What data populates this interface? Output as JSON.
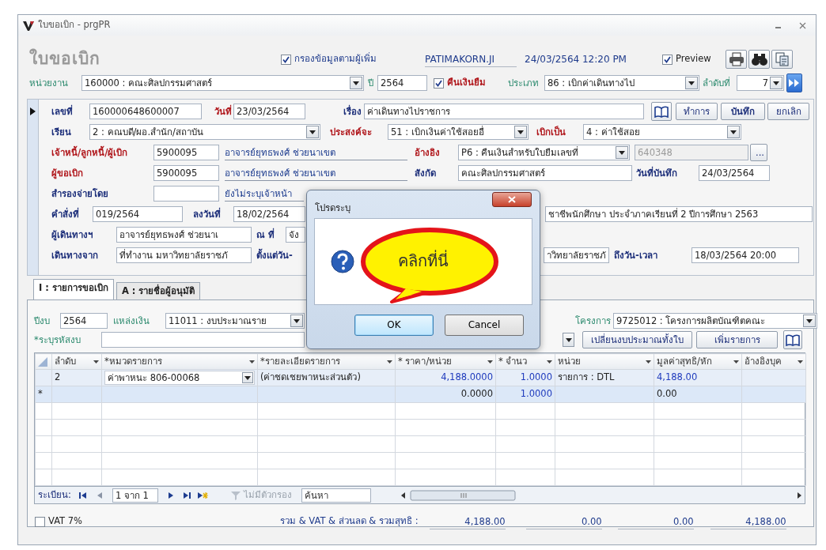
{
  "window": {
    "title": "ใบขอเบิก - prgPR"
  },
  "header": {
    "items": [
      {
        "kind": "heading",
        "text": "ใบขอเบิก"
      },
      {
        "kind": "checkbox",
        "label": "กรองข้อมูลตามผู้เพิ่ม",
        "checked": true
      },
      {
        "kind": "info",
        "text": "PATIMAKORN.JI"
      },
      {
        "kind": "info",
        "text": "24/03/2564  12:20 PM"
      },
      {
        "kind": "checkbox",
        "label": "Preview",
        "checked": true
      },
      {
        "kind": "icon_button"
      },
      {
        "kind": "icon_button"
      },
      {
        "kind": "icon_button"
      }
    ]
  },
  "selector": {
    "items": [
      {
        "kind": "label",
        "text": "หน่วยงาน"
      },
      {
        "kind": "combo",
        "value": "160000 : คณะศิลปกรรมศาสตร์"
      },
      {
        "kind": "label",
        "text": "ปี"
      },
      {
        "kind": "field",
        "value": "2564"
      },
      {
        "kind": "checkbox",
        "label": "คืนเงินยืม",
        "checked": true
      },
      {
        "kind": "label",
        "text": "ประเภท"
      },
      {
        "kind": "combo",
        "value": "86 : เบิกค่าเดินทางไป"
      },
      {
        "kind": "label",
        "text": "ลำดับที่"
      },
      {
        "kind": "combo",
        "value": "7"
      },
      {
        "kind": "icon_button"
      }
    ]
  },
  "form": {
    "rows": [
      {
        "items": [
          {
            "kind": "label",
            "text": "เลขที่",
            "required": false
          },
          {
            "kind": "field",
            "value": "160000648600007"
          },
          {
            "kind": "label",
            "text": "วันที่",
            "required": true
          },
          {
            "kind": "field",
            "value": "23/03/2564"
          },
          {
            "kind": "label",
            "text": "เรื่อง",
            "required": false
          },
          {
            "kind": "field",
            "value": "ค่าเดินทางไปราชการ"
          },
          {
            "kind": "icon_button"
          },
          {
            "kind": "button",
            "text": "ทำการ"
          },
          {
            "kind": "button",
            "text": "บันทึก"
          },
          {
            "kind": "button",
            "text": "ยกเลิก"
          }
        ]
      },
      {
        "items": [
          {
            "kind": "label",
            "text": "เรียน",
            "required": false
          },
          {
            "kind": "combo",
            "value": "2 : คณบดี/ผอ.สำนัก/สถาบัน"
          },
          {
            "kind": "label",
            "text": "ประสงค์จะ",
            "required": true
          },
          {
            "kind": "combo",
            "value": "51 : เบิกเงินค่าใช้สอยอื่"
          },
          {
            "kind": "label",
            "text": "เบิกเป็น",
            "required": true
          },
          {
            "kind": "combo",
            "value": "4 : ค่าใช้สอย"
          }
        ]
      },
      {
        "items": [
          {
            "kind": "label",
            "text": "เจ้าหนี้/ลูกหนี้/ผู้เบิก",
            "required": true
          },
          {
            "kind": "field",
            "value": "5900095"
          },
          {
            "kind": "name",
            "text": "อาจารย์ยุทธพงศ์ ช่วยนาเขต"
          },
          {
            "kind": "label",
            "text": "อ้างอิง",
            "required": true
          },
          {
            "kind": "combo",
            "value": "P6 : คืนเงินสำหรับใบยืมเลขที่"
          },
          {
            "kind": "readonly_field",
            "value": "640348"
          },
          {
            "kind": "button",
            "text": "..."
          }
        ]
      },
      {
        "items": [
          {
            "kind": "label",
            "text": "ผู้ขอเบิก",
            "required": true
          },
          {
            "kind": "field",
            "value": "5900095"
          },
          {
            "kind": "name",
            "text": "อาจารย์ยุทธพงศ์ ช่วยนาเขต"
          },
          {
            "kind": "label",
            "text": "สังกัด",
            "required": false
          },
          {
            "kind": "field",
            "value": "คณะศิลปกรรมศาสตร์"
          },
          {
            "kind": "label",
            "text": "วันที่บันทึก",
            "required": false
          },
          {
            "kind": "field",
            "value": "24/03/2564"
          }
        ]
      },
      {
        "items": [
          {
            "kind": "label",
            "text": "สำรองจ่ายโดย",
            "required": false
          },
          {
            "kind": "field"
          },
          {
            "kind": "name",
            "text": "ยังไม่ระบุเจ้าหน้า"
          }
        ]
      },
      {
        "items": [
          {
            "kind": "label",
            "text": "คำสั่งที่",
            "required": false
          },
          {
            "kind": "field",
            "value": "019/2564"
          },
          {
            "kind": "label",
            "text": "ลงวันที่",
            "required": false
          },
          {
            "kind": "field",
            "value": "18/02/2564"
          }
        ],
        "items_after_dialog": [
          {
            "kind": "field",
            "value": "ชาชีพนักศึกษา ประจำภาคเรียนที่ 2 ปีการศึกษา 2563"
          }
        ]
      },
      {
        "items": [
          {
            "kind": "label",
            "text": "ผู้เดินทางฯ",
            "required": false
          },
          {
            "kind": "field",
            "value": "อาจารย์ยุทธพงศ์ ช่วยนาเ"
          },
          {
            "kind": "label",
            "text": "ณ ที่",
            "required": false
          },
          {
            "kind": "field",
            "value": "จัง"
          }
        ]
      },
      {
        "items": [
          {
            "kind": "label",
            "text": "เดินทางจาก",
            "required": false
          },
          {
            "kind": "field",
            "value": "ที่ทำงาน มหาวิทยาลัยราชภั"
          },
          {
            "kind": "label",
            "text": "ตั้งแต่วัน-",
            "required": false
          }
        ],
        "items_after_dialog": [
          {
            "kind": "field",
            "value": "าวิทยาลัยราชภั"
          },
          {
            "kind": "label",
            "text": "ถึงวัน-เวลา",
            "required": false
          },
          {
            "kind": "field",
            "value": "18/03/2564  20:00"
          }
        ]
      }
    ]
  },
  "tabs": [
    {
      "label": "I : รายการขอเบิก",
      "selected": true
    },
    {
      "label": "A : รายชื่อผู้อนุมัติ",
      "selected": false
    }
  ],
  "budget": {
    "rows": [
      {
        "items": [
          {
            "kind": "label",
            "text": "ปีงบ"
          },
          {
            "kind": "field",
            "value": "2564"
          },
          {
            "kind": "label",
            "text": "แหล่งเงิน"
          },
          {
            "kind": "combo",
            "value": "11011 : งบประมาณราย"
          }
        ],
        "items_after_dialog": [
          {
            "kind": "label",
            "text": "โครงการ"
          },
          {
            "kind": "combo",
            "value": "9725012 : โครงการผลิตบัณฑิตคณะ"
          }
        ]
      },
      {
        "items": [
          {
            "kind": "label",
            "text": "*ระบุรหัสงบ"
          },
          {
            "kind": "field"
          }
        ],
        "items_after_dialog": [
          {
            "kind": "dropdown_button"
          },
          {
            "kind": "button",
            "text": "เปลี่ยนงบประมาณทั้งใบ"
          },
          {
            "kind": "button",
            "text": "เพิ่มรายการ"
          },
          {
            "kind": "icon_button"
          }
        ]
      }
    ]
  },
  "grid": {
    "columns": [
      {
        "label": "ลำดับ",
        "kind": "text"
      },
      {
        "label": "*หมวดรายการ",
        "kind": "combo"
      },
      {
        "label": "*รายละเอียดรายการ",
        "kind": "text"
      },
      {
        "label": "* ราคา/หน่วย",
        "kind": "number"
      },
      {
        "label": "* จำนว",
        "kind": "number"
      },
      {
        "label": "หน่วย",
        "kind": "text"
      },
      {
        "label": "มูลค่าสุทธิ/หัก",
        "kind": "text"
      },
      {
        "label": "อ้างอิงบุค",
        "kind": "text"
      }
    ],
    "rows": [
      {
        "cells": [
          "2",
          "ค่าพาหนะ 806-00068",
          "(ค่าชดเชยพาหนะส่วนตัว)",
          "4,188.0000",
          "1.0000",
          "รายการ : DTL",
          "4,188.00",
          null
        ]
      },
      {
        "marker": "*",
        "cells": [
          null,
          null,
          null,
          "0.0000",
          "1.0000",
          null,
          "0.00",
          null
        ]
      }
    ],
    "navigator": {
      "label": "ระเบียน:",
      "position": "1 จาก 1",
      "filter": "ไม่มีตัวกรอง",
      "search_placeholder": "ค้นหา"
    }
  },
  "footer": {
    "vat": {
      "label": "VAT 7%",
      "checked": false
    },
    "total_label": "รวม & VAT & ส่วนลด & รวมสุทธิ :",
    "totals": [
      "4,188.00",
      "0.00",
      "0.00",
      "4,188.00"
    ]
  },
  "dialog": {
    "title": "โปรดระบุ",
    "callout": "คลิกที่นี่",
    "buttons": [
      {
        "label": "OK",
        "focused": true
      },
      {
        "label": "Cancel",
        "focused": false
      }
    ]
  }
}
